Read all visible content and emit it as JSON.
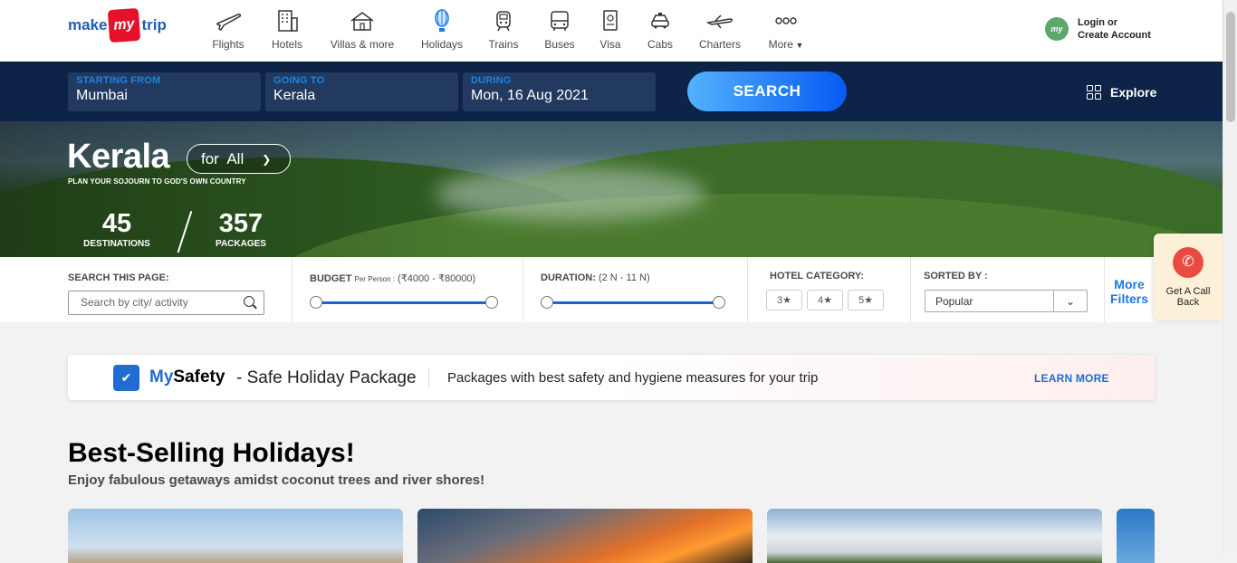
{
  "brand": {
    "p1": "make",
    "p2": "my",
    "p3": "trip"
  },
  "nav": [
    {
      "label": "Flights",
      "icon": "flight-icon"
    },
    {
      "label": "Hotels",
      "icon": "hotel-icon"
    },
    {
      "label": "Villas & more",
      "icon": "villa-icon"
    },
    {
      "label": "Holidays",
      "icon": "holidays-icon"
    },
    {
      "label": "Trains",
      "icon": "train-icon"
    },
    {
      "label": "Buses",
      "icon": "bus-icon"
    },
    {
      "label": "Visa",
      "icon": "visa-icon"
    },
    {
      "label": "Cabs",
      "icon": "cab-icon"
    },
    {
      "label": "Charters",
      "icon": "charter-icon"
    },
    {
      "label": "More",
      "icon": "more-icon"
    }
  ],
  "login": {
    "avatar": "my",
    "line1": "Login or",
    "line2": "Create Account"
  },
  "search": {
    "from_label": "STARTING FROM",
    "from_value": "Mumbai",
    "to_label": "GOING TO",
    "to_value": "Kerala",
    "during_label": "DURING",
    "during_value": "Mon, 16 Aug 2021",
    "button": "SEARCH",
    "explore": "Explore"
  },
  "hero": {
    "title": "Kerala",
    "for_all": "for  All",
    "subtitle": "PLAN YOUR SOJOURN TO GOD'S OWN COUNTRY",
    "destinations_count": "45",
    "destinations_label": "DESTINATIONS",
    "packages_count": "357",
    "packages_label": "PACKAGES"
  },
  "filters": {
    "search_label": "SEARCH THIS PAGE:",
    "search_placeholder": "Search by city/ activity",
    "budget_label": "BUDGET",
    "budget_small": "Per Person :",
    "budget_range": " (₹4000 - ₹80000)",
    "duration_label": "DURATION:",
    "duration_range": " (2 N - 11 N)",
    "hotel_label": "HOTEL CATEGORY:",
    "stars": [
      "3★",
      "4★",
      "5★"
    ],
    "sort_label": "SORTED BY :",
    "sort_value": "Popular",
    "more_filters_1": "More",
    "more_filters_2": "Filters"
  },
  "callback": {
    "line1": "Get A Call",
    "line2": "Back"
  },
  "safety": {
    "my": "My",
    "safety": "Safety",
    "sub": "- Safe Holiday Package",
    "desc": "Packages with best safety and hygiene measures for your trip",
    "learn": "LEARN MORE"
  },
  "section": {
    "title": "Best-Selling Holidays!",
    "subtitle": "Enjoy fabulous getaways amidst coconut trees and river shores!"
  },
  "colors": {
    "navy": "#0d2348",
    "accent": "#1f6dd2",
    "brand_red": "#e5112b"
  }
}
